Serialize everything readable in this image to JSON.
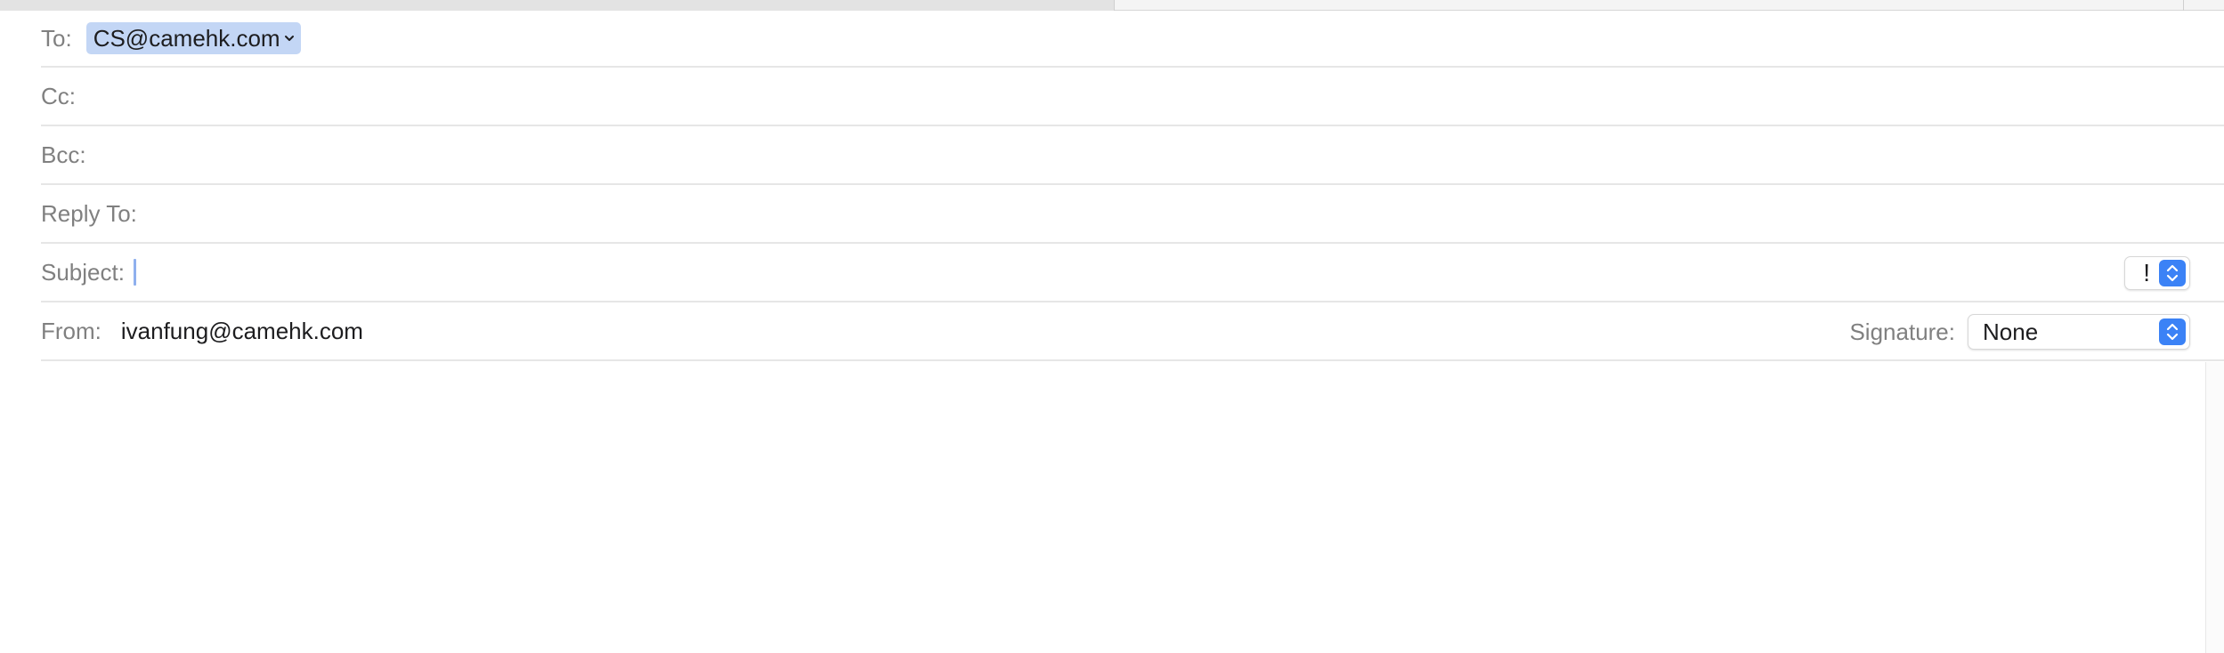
{
  "header": {
    "to": {
      "label": "To:",
      "recipient": "CS@camehk.com"
    },
    "cc": {
      "label": "Cc:",
      "value": ""
    },
    "bcc": {
      "label": "Bcc:",
      "value": ""
    },
    "reply_to": {
      "label": "Reply To:",
      "value": ""
    },
    "subject": {
      "label": "Subject:",
      "value": ""
    },
    "priority": {
      "symbol": "!"
    },
    "from": {
      "label": "From:",
      "value": "ivanfung@camehk.com"
    },
    "signature": {
      "label": "Signature:",
      "selected": "None"
    }
  },
  "colors": {
    "token_bg": "#c3d6f5",
    "accent": "#3b82f6",
    "label_gray": "#808080"
  }
}
